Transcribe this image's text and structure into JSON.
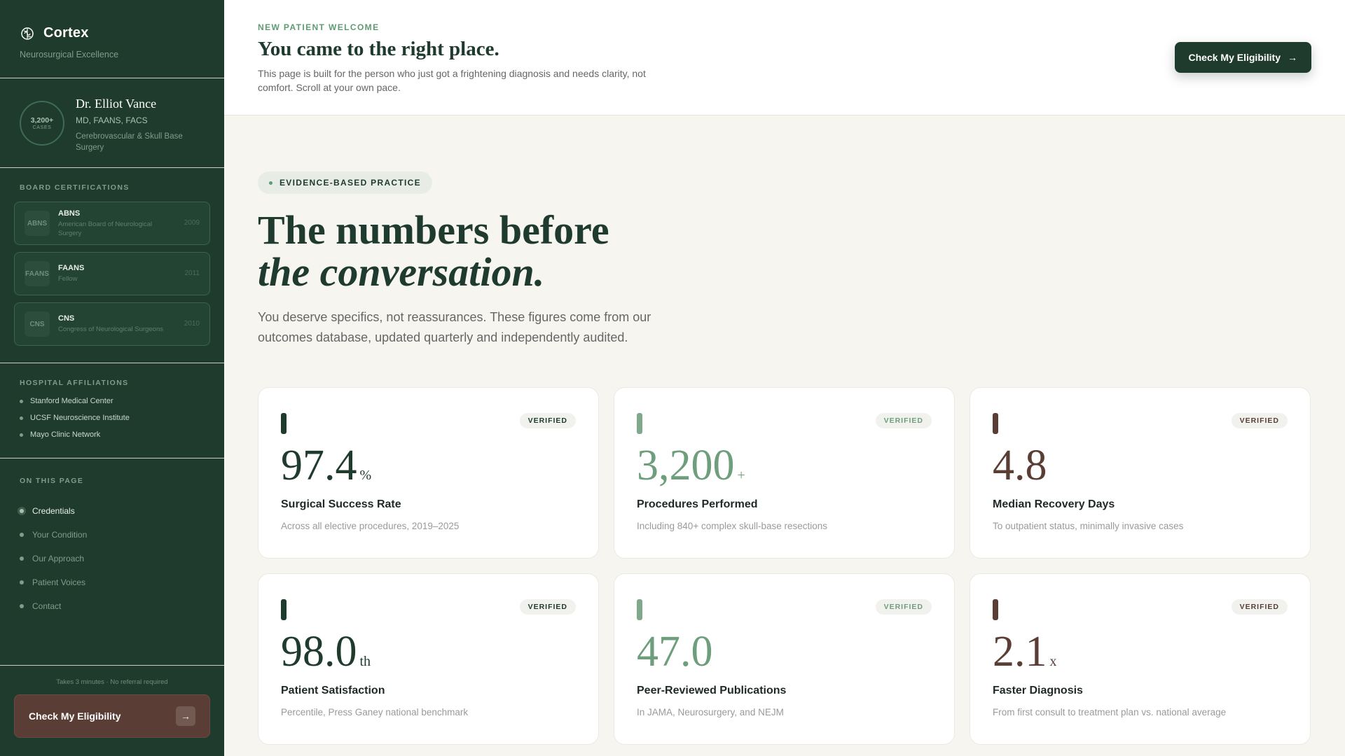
{
  "sidebar": {
    "brand": {
      "name": "Cortex",
      "tagline": "Neurosurgical Excellence",
      "logo_icon": "brain-icon"
    },
    "doctor": {
      "cases_number": "3,200+",
      "cases_label": "CASES",
      "name": "Dr. Elliot Vance",
      "credentials": "MD, FAANS, FACS",
      "specialty": "Cerebrovascular & Skull Base Surgery"
    },
    "certifications": {
      "label": "BOARD CERTIFICATIONS",
      "items": [
        {
          "abbr": "ABNS",
          "title": "ABNS",
          "desc": "American Board of Neurological Surgery",
          "year": "2009"
        },
        {
          "abbr": "FAANS",
          "title": "FAANS",
          "desc": "Fellow",
          "year": "2011"
        },
        {
          "abbr": "CNS",
          "title": "CNS",
          "desc": "Congress of Neurological Surgeons",
          "year": "2010"
        }
      ]
    },
    "affiliations": {
      "label": "HOSPITAL AFFILIATIONS",
      "items": [
        "Stanford Medical Center",
        "UCSF Neuroscience Institute",
        "Mayo Clinic Network"
      ]
    },
    "nav": {
      "label": "ON THIS PAGE",
      "items": [
        "Credentials",
        "Your Condition",
        "Our Approach",
        "Patient Voices",
        "Contact"
      ]
    },
    "cta": {
      "note": "Takes 3 minutes · No referral required",
      "label": "Check My Eligibility"
    }
  },
  "topbar": {
    "eyebrow": "NEW PATIENT WELCOME",
    "title": "You came to the right place.",
    "desc": "This page is built for the person who just got a frightening diagnosis and needs clarity, not comfort. Scroll at your own pace.",
    "button": "Check My Eligibility"
  },
  "hero": {
    "pill": "EVIDENCE-BASED PRACTICE",
    "title_line1": "The numbers before",
    "title_line2": "the conversation.",
    "lead": "You deserve specifics, not reassurances. These figures come from our outcomes database, updated quarterly and independently audited."
  },
  "stats": [
    {
      "badge": "VERIFIED",
      "value": "97.4",
      "unit": "%",
      "title": "Surgical Success Rate",
      "desc": "Across all elective procedures, 2019–2025"
    },
    {
      "badge": "VERIFIED",
      "value": "3,200",
      "unit": "+",
      "title": "Procedures Performed",
      "desc": "Including 840+ complex skull-base resections"
    },
    {
      "badge": "VERIFIED",
      "value": "4.8",
      "unit": "",
      "title": "Median Recovery Days",
      "desc": "To outpatient status, minimally invasive cases"
    },
    {
      "badge": "VERIFIED",
      "value": "98.0",
      "unit": "th",
      "title": "Patient Satisfaction",
      "desc": "Percentile, Press Ganey national benchmark"
    },
    {
      "badge": "VERIFIED",
      "value": "47.0",
      "unit": "",
      "title": "Peer-Reviewed Publications",
      "desc": "In JAMA, Neurosurgery, and NEJM"
    },
    {
      "badge": "VERIFIED",
      "value": "2.1",
      "unit": "x",
      "title": "Faster Diagnosis",
      "desc": "From first consult to treatment plan vs. national average"
    }
  ],
  "colors": {
    "sidebar": "#1e3b2d",
    "accent_green": "#6f9e7c",
    "accent_brown": "#5a3e35",
    "background": "#f7f5f0"
  }
}
